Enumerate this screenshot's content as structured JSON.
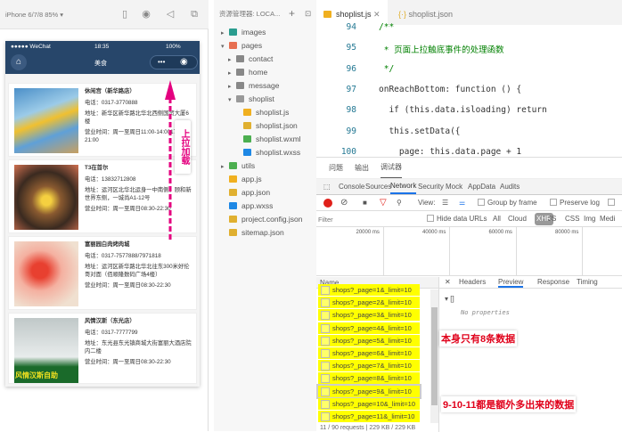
{
  "simulator": {
    "device": "iPhone 6/7/8 85% ▾",
    "carrier": "●●●●● WeChat",
    "time": "18:35",
    "battery": "100%",
    "title": "美食",
    "more": "•••",
    "pull_label": "上拉加载",
    "shops": [
      {
        "name": "休闲宫（新华路店）",
        "phone": "电话：0317-3770888",
        "addr": "地址：新华区新华路北华北西侧国贸大厦6楼",
        "hours": "营业时间：周一至周日11:00-14:0017:00-21:00"
      },
      {
        "name": "T3在首尔",
        "phone": "电话：13832712808",
        "addr": "地址：运河区北华北运身一中南侧，颐和新世界东侧，一城尚A1-12号",
        "hours": "营业时间：周一至周日08:30-22:30"
      },
      {
        "name": "富丽园白肉烤肉城",
        "phone": "电话：0317-7577888/7971818",
        "addr": "地址：运河区新华路北华北往东300米好伦哥对面（佰顺隆数码广场4楼）",
        "hours": "营业时间：周一至周日08:30-22:30"
      },
      {
        "name": "风情汉斯（东光店）",
        "phone": "电话：0317-7777799",
        "addr": "地址：东光县东光镇商城大街富丽大酒店院内二楼",
        "hours": "营业时间：周一至周日08:30-22:30"
      }
    ],
    "img_caption": "风情汉斯自助"
  },
  "explorer": {
    "title": "资源管理器: LOCA...",
    "items": [
      "images",
      "pages",
      "contact",
      "home",
      "message",
      "shoplist",
      "shoplist.js",
      "shoplist.json",
      "shoplist.wxml",
      "shoplist.wxss",
      "utils",
      "app.js",
      "app.json",
      "app.wxss",
      "project.config.json",
      "sitemap.json"
    ]
  },
  "editor": {
    "tabs": [
      "shoplist.js",
      "shoplist.json"
    ],
    "lines": [
      {
        "n": "94",
        "code": "/**"
      },
      {
        "n": "95",
        "code": " * 页面上拉触底事件的处理函数"
      },
      {
        "n": "96",
        "code": " */"
      },
      {
        "n": "97",
        "code": "onReachBottom: function () {"
      },
      {
        "n": "98",
        "code": "  if (this.data.isloading) return"
      },
      {
        "n": "99",
        "code": "  this.setData({"
      },
      {
        "n": "100",
        "code": "    page: this.data.page + 1"
      }
    ]
  },
  "devtools": {
    "panel_tabs": [
      "问题",
      "输出",
      "调试器"
    ],
    "tabs": [
      "Console",
      "Sources",
      "Network",
      "Security",
      "Mock",
      "AppData",
      "Audits"
    ],
    "view_label": "View:",
    "group_by_frame": "Group by frame",
    "preserve_log": "Preserve log",
    "filter_placeholder": "Filter",
    "hide_data_urls": "Hide data URLs",
    "types": [
      "All",
      "Cloud",
      "XHR",
      "JS",
      "CSS",
      "Img",
      "Medi"
    ],
    "timeline": [
      "20000 ms",
      "40000 ms",
      "60000 ms",
      "80000 ms"
    ],
    "name_header": "Name",
    "detail_tabs": [
      "Headers",
      "Preview",
      "Response",
      "Timing"
    ],
    "preview_root": "▾ []",
    "preview_empty": "No properties",
    "requests": [
      "shops?_page=1&_limit=10",
      "shops?_page=2&_limit=10",
      "shops?_page=3&_limit=10",
      "shops?_page=4&_limit=10",
      "shops?_page=5&_limit=10",
      "shops?_page=6&_limit=10",
      "shops?_page=7&_limit=10",
      "shops?_page=8&_limit=10",
      "shops?_page=9&_limit=10",
      "shops?_page=10&_limit=10",
      "shops?_page=11&_limit=10"
    ],
    "status": "11 / 90 requests  |  229 KB / 229 KB",
    "annotation1": "本身只有8条数据",
    "annotation2": "9-10-11都是额外多出来的数据"
  }
}
